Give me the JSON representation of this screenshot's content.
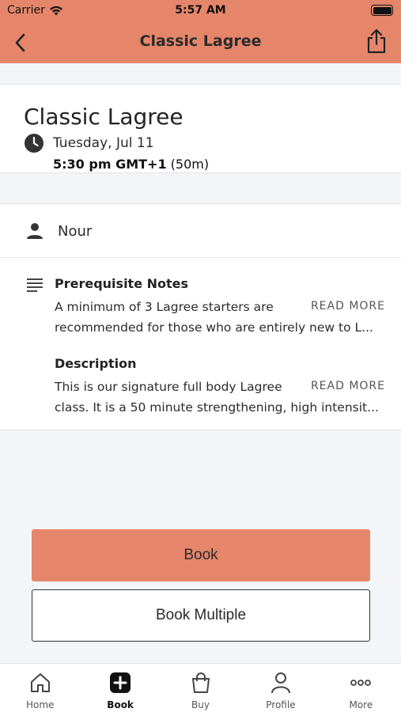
{
  "status_bar": {
    "carrier": "Carrier",
    "time": "5:57 AM"
  },
  "nav": {
    "title": "Classic Lagree",
    "back_icon": "chevron-left-icon",
    "share_icon": "share-icon"
  },
  "colors": {
    "accent": "#e5866b",
    "background": "#f4f5f8"
  },
  "class_info": {
    "title": "Classic Lagree",
    "date": "Tuesday, Jul 11",
    "time": "5:30 pm GMT+1",
    "duration": "(50m)"
  },
  "instructor": {
    "name": "Nour"
  },
  "prerequisite": {
    "title": "Prerequisite Notes",
    "line1": "A minimum of 3 Lagree starters are",
    "line2": "recommended for those who are entirely new to L...",
    "read_more": "READ MORE"
  },
  "description": {
    "title": "Description",
    "line1": "This is our signature full body Lagree",
    "line2": "class. It is a 50 minute strengthening, high intensit...",
    "read_more": "READ MORE"
  },
  "actions": {
    "book": "Book",
    "book_multiple": "Book Multiple"
  },
  "tabs": [
    {
      "label": "Home",
      "icon": "home-icon"
    },
    {
      "label": "Book",
      "icon": "plus-square-icon",
      "active": true
    },
    {
      "label": "Buy",
      "icon": "shopping-bag-icon"
    },
    {
      "label": "Profile",
      "icon": "user-icon"
    },
    {
      "label": "More",
      "icon": "more-icon"
    }
  ]
}
